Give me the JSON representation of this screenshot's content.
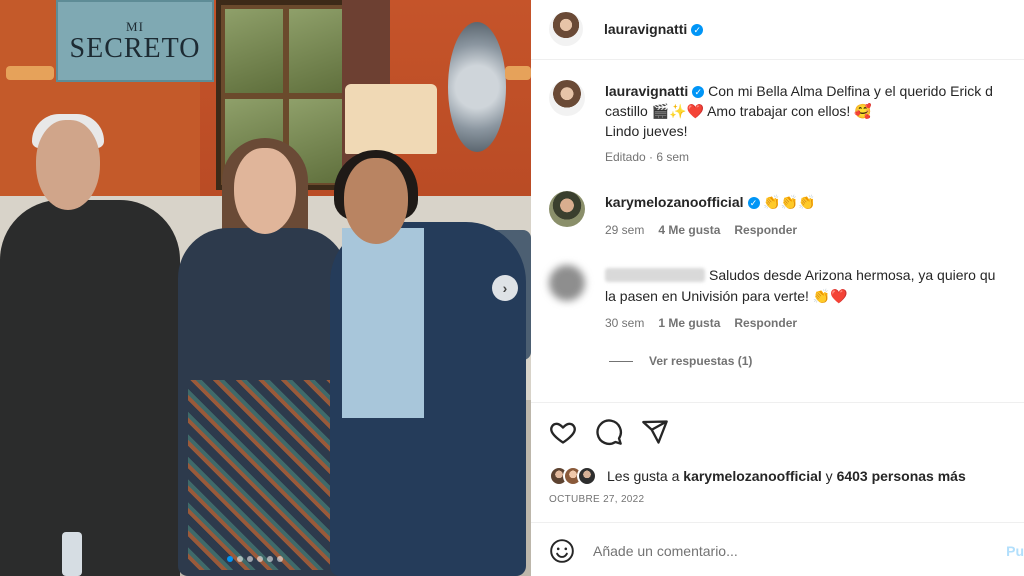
{
  "photo": {
    "sign_top": "MI",
    "sign_main": "SECRETO",
    "carousel_dots": 6,
    "carousel_active_index": 0
  },
  "header": {
    "username": "lauravignatti",
    "verified": true
  },
  "caption": {
    "username": "lauravignatti",
    "line1": "Con mi Bella Alma Delfina y el querido Erick d",
    "line2": "castillo 🎬✨❤️ Amo trabajar con ellos! 🥰",
    "line3": "Lindo jueves!",
    "meta": "Editado · 6 sem"
  },
  "comments": [
    {
      "username": "karymelozanoofficial",
      "verified": true,
      "text": "👏👏👏",
      "age": "29 sem",
      "likes": "4 Me gusta",
      "reply": "Responder"
    },
    {
      "username": "",
      "text_line1": "Saludos desde Arizona hermosa, ya quiero qu",
      "text_line2": "la pasen en Univisión para verte! 👏❤️",
      "age": "30 sem",
      "likes": "1 Me gusta",
      "reply": "Responder"
    }
  ],
  "view_replies": "Ver respuestas (1)",
  "likes": {
    "prefix": "Les gusta a",
    "user": "karymelozanoofficial",
    "joiner": "y",
    "others": "6403 personas más"
  },
  "date": "OCTUBRE 27, 2022",
  "comment_box": {
    "placeholder": "Añade un comentario...",
    "post_label": "Pu"
  },
  "colors": {
    "accent": "#0095f6",
    "muted_text": "#737373",
    "post_disabled": "#b2dffc"
  }
}
